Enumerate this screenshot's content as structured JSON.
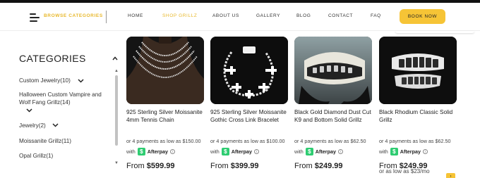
{
  "header": {
    "browse_label": "BROWSE CATEGORIES",
    "nav": [
      "HOME",
      "SHOP GRILLZ",
      "ABOUT US",
      "GALLERY",
      "BLOG",
      "CONTACT",
      "FAQ"
    ],
    "active_nav": "SHOP GRILLZ",
    "book_button": "BOOK NOW"
  },
  "sidebar": {
    "title": "CATEGORIES",
    "items": [
      {
        "label": "Custom Jewelry",
        "count": "(10)"
      },
      {
        "label": "Halloween Custom Vampire and Wolf Fang Grillz",
        "count": "(14)"
      },
      {
        "label": "Jewelry",
        "count": "(2)"
      },
      {
        "label": "Moissanite Grillz",
        "count": "(11)"
      },
      {
        "label": "Opal Grillz",
        "count": "(1)"
      }
    ]
  },
  "products": [
    {
      "title": "925 Sterling Silver Moissanite 4mm Tennis Chain",
      "installment": "or 4 payments as low as $150.00",
      "afterpay_prefix": "with",
      "afterpay_label": "Afterpay",
      "price_prefix": "From",
      "price": "$599.99"
    },
    {
      "title": "925 Sterling Silver Moissanite Gothic Cross Link Bracelet",
      "installment": "or 4 payments as low as $100.00",
      "afterpay_prefix": "with",
      "afterpay_label": "Afterpay",
      "price_prefix": "From",
      "price": "$399.99"
    },
    {
      "title": "Black Gold Diamond Dust Cut K9 and Bottom Solid Grillz",
      "installment": "or 4 payments as low as $62.50",
      "afterpay_prefix": "with",
      "afterpay_label": "Afterpay",
      "price_prefix": "From",
      "price": "$249.99"
    },
    {
      "title": "Black Rhodium Classic Solid Grillz",
      "installment": "or 4 payments as low as $62.50",
      "afterpay_prefix": "with",
      "afterpay_label": "Afterpay",
      "price_prefix": "From",
      "price": "$249.99",
      "extra": "or as low as $23/mo"
    }
  ],
  "colors": {
    "accent": "#f6c436",
    "active_nav": "#e8b82b",
    "afterpay": "#2ecc71"
  }
}
